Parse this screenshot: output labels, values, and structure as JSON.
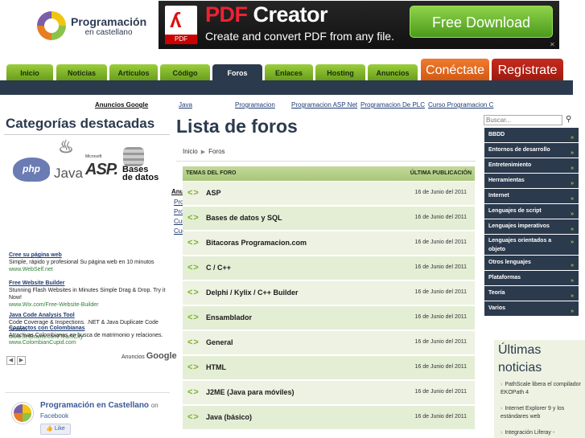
{
  "header": {
    "logo_title": "Programación",
    "logo_subtitle": "en castellano",
    "banner": {
      "pdf_label": "PDF",
      "brand_pdf": "PDF",
      "brand_rest": " Creator",
      "tagline": "Create and convert PDF from any file.",
      "download": "Free Download"
    }
  },
  "nav": {
    "tabs": [
      "Inicio",
      "Noticias",
      "Artículos",
      "Código",
      "Foros",
      "Enlaces",
      "Hosting",
      "Anuncios"
    ],
    "active_tab": "Foros",
    "connect": "Conéctate",
    "register": "Regístrate"
  },
  "ad_links": {
    "label": "Anuncios Google",
    "items": [
      "Java",
      "Programacion",
      "Programacion ASP Net",
      "Programacion De PLC",
      "Curso Programacion C"
    ]
  },
  "left": {
    "title": "Categorías destacadas",
    "tech": {
      "php": "php",
      "java": "Java",
      "microsoft": "Microsoft",
      "asp": "ASP.",
      "bases": "Bases",
      "datos": "de datos"
    },
    "side_links": [
      "Anu",
      "Pro",
      "Pro",
      "Cur",
      "Cur"
    ],
    "ads": [
      {
        "title": "Cree su página web",
        "desc": "Simple, rápido y profesional Su página web en 10 minutos",
        "url": "www.WebSelf.net"
      },
      {
        "title": "Free Website Builder",
        "desc": "Stunning Flash Websites in Minutes Simple Drag & Drop. Try it Now!",
        "url": "www.Wix.com/Free-Website-Builder"
      },
      {
        "title": "Java Code Analysis Tool",
        "desc": "Code Coverage & Inspections. .NET & Java Duplicate Code Search.",
        "url": "www.JetBrains.com/TeamCity"
      },
      {
        "title": "Contactos con Colombianas",
        "desc": "Atractivas Colombianas en busca de matrimonio y relaciones.",
        "url": "www.ColombianCupid.com"
      }
    ],
    "ads_footer": "Anuncios",
    "ads_google": "Google",
    "facebook": {
      "title": "Programación en Castellano",
      "on": "on",
      "network": "Facebook",
      "like": "Like"
    }
  },
  "main": {
    "title": "Lista de foros",
    "breadcrumb": [
      "Inicio",
      "Foros"
    ],
    "col_topics": "TEMAS DEL FORO",
    "col_last": "ÚLTIMA PUBLICACIÓN",
    "forums": [
      {
        "name": "ASP",
        "date": "16 de Junio del 2011"
      },
      {
        "name": "Bases de datos y SQL",
        "date": "16 de Junio del 2011"
      },
      {
        "name": "Bitacoras Programacion.com",
        "date": "16 de Junio del 2011"
      },
      {
        "name": "C / C++",
        "date": "16 de Junio del 2011"
      },
      {
        "name": "Delphi / Kylix / C++ Builder",
        "date": "16 de Junio del 2011"
      },
      {
        "name": "Ensamblador",
        "date": "16 de Junio del 2011"
      },
      {
        "name": "General",
        "date": "16 de Junio del 2011"
      },
      {
        "name": "HTML",
        "date": "16 de Junio del 2011"
      },
      {
        "name": "J2ME (Java para móviles)",
        "date": "16 de Junio del 2011"
      },
      {
        "name": "Java (básico)",
        "date": "16 de Junio del 2011"
      }
    ]
  },
  "right": {
    "search_placeholder": "Buscar...",
    "categories": [
      "BBDD",
      "Entornos de desarrollo",
      "Entretenimiento",
      "Herramientas",
      "Internet",
      "Lenguajes de script",
      "Lenguajes imperativos",
      "Lenguajes orientados a objeto",
      "Otros lenguajes",
      "Plataformas",
      "Teoría",
      "Varios"
    ],
    "latest_title_1": "Últimas",
    "latest_title_2": "noticias",
    "latest": [
      "PathScale libera el compilador EKOPath 4",
      "Internet Explorer 9 y los estándares web",
      "Integración Liferay -"
    ]
  },
  "colors": {
    "nav_dark": "#2c3a4d",
    "tab_green": "#8bbf30",
    "connect": "#e8681f",
    "register": "#b52316",
    "row_bg": "#e9f0dc"
  }
}
